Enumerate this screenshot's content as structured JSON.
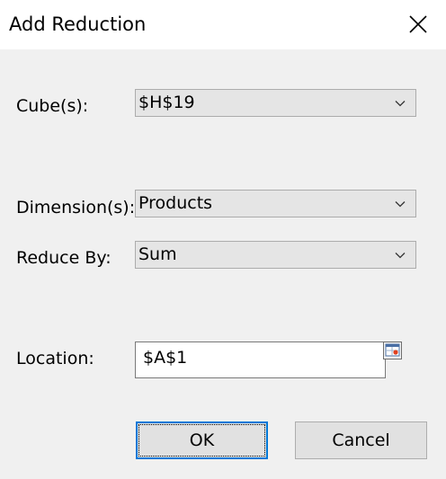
{
  "window": {
    "title": "Add Reduction",
    "close_icon": "close-icon"
  },
  "form": {
    "cube": {
      "label": "Cube(s):",
      "value": "$H$19"
    },
    "dimension": {
      "label": "Dimension(s):",
      "value": "Products"
    },
    "reduce_by": {
      "label": "Reduce By:",
      "value": "Sum"
    },
    "location": {
      "label": "Location:",
      "value": "$A$1",
      "picker_icon": "range-select-icon"
    }
  },
  "buttons": {
    "ok": "OK",
    "cancel": "Cancel"
  },
  "colors": {
    "background": "#f0f0f0",
    "titlebar": "#ffffff",
    "combo_fill": "#e5e5e5",
    "accent": "#0078d7"
  }
}
